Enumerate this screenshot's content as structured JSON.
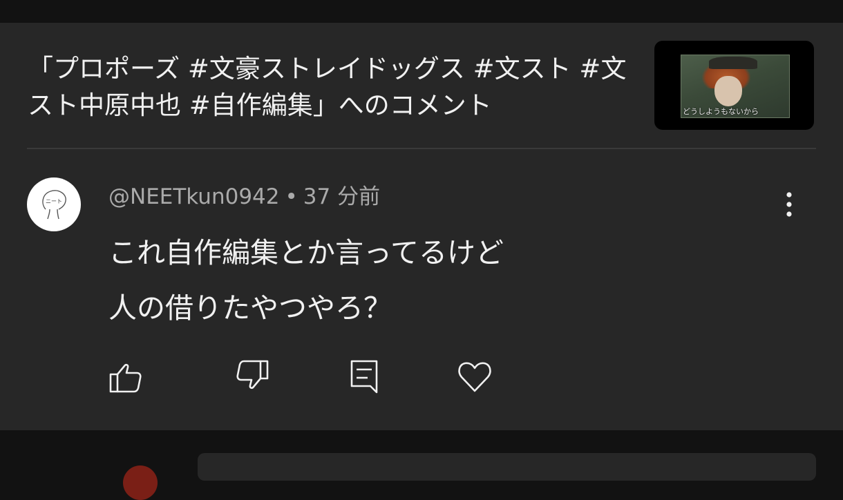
{
  "video": {
    "title": "「プロポーズ #文豪ストレイドッグス #文スト #文スト中原中也 #自作編集」へのコメント",
    "thumbnail_caption": "どうしようもないから"
  },
  "comment": {
    "author": "@NEETkun0942",
    "separator": "•",
    "time_ago": "37 分前",
    "avatar_text": "ニート",
    "text_lines": [
      "これ自作編集とか言ってるけど",
      "人の借りたやつやろ？"
    ]
  },
  "actions": [
    {
      "name": "like",
      "icon": "thumbs-up-icon"
    },
    {
      "name": "dislike",
      "icon": "thumbs-down-icon"
    },
    {
      "name": "reply",
      "icon": "comment-icon"
    },
    {
      "name": "heart",
      "icon": "heart-icon"
    }
  ],
  "colors": {
    "background": "#121212",
    "card": "#272727",
    "text_primary": "#f1f1f1",
    "text_secondary": "#aaaaaa"
  }
}
